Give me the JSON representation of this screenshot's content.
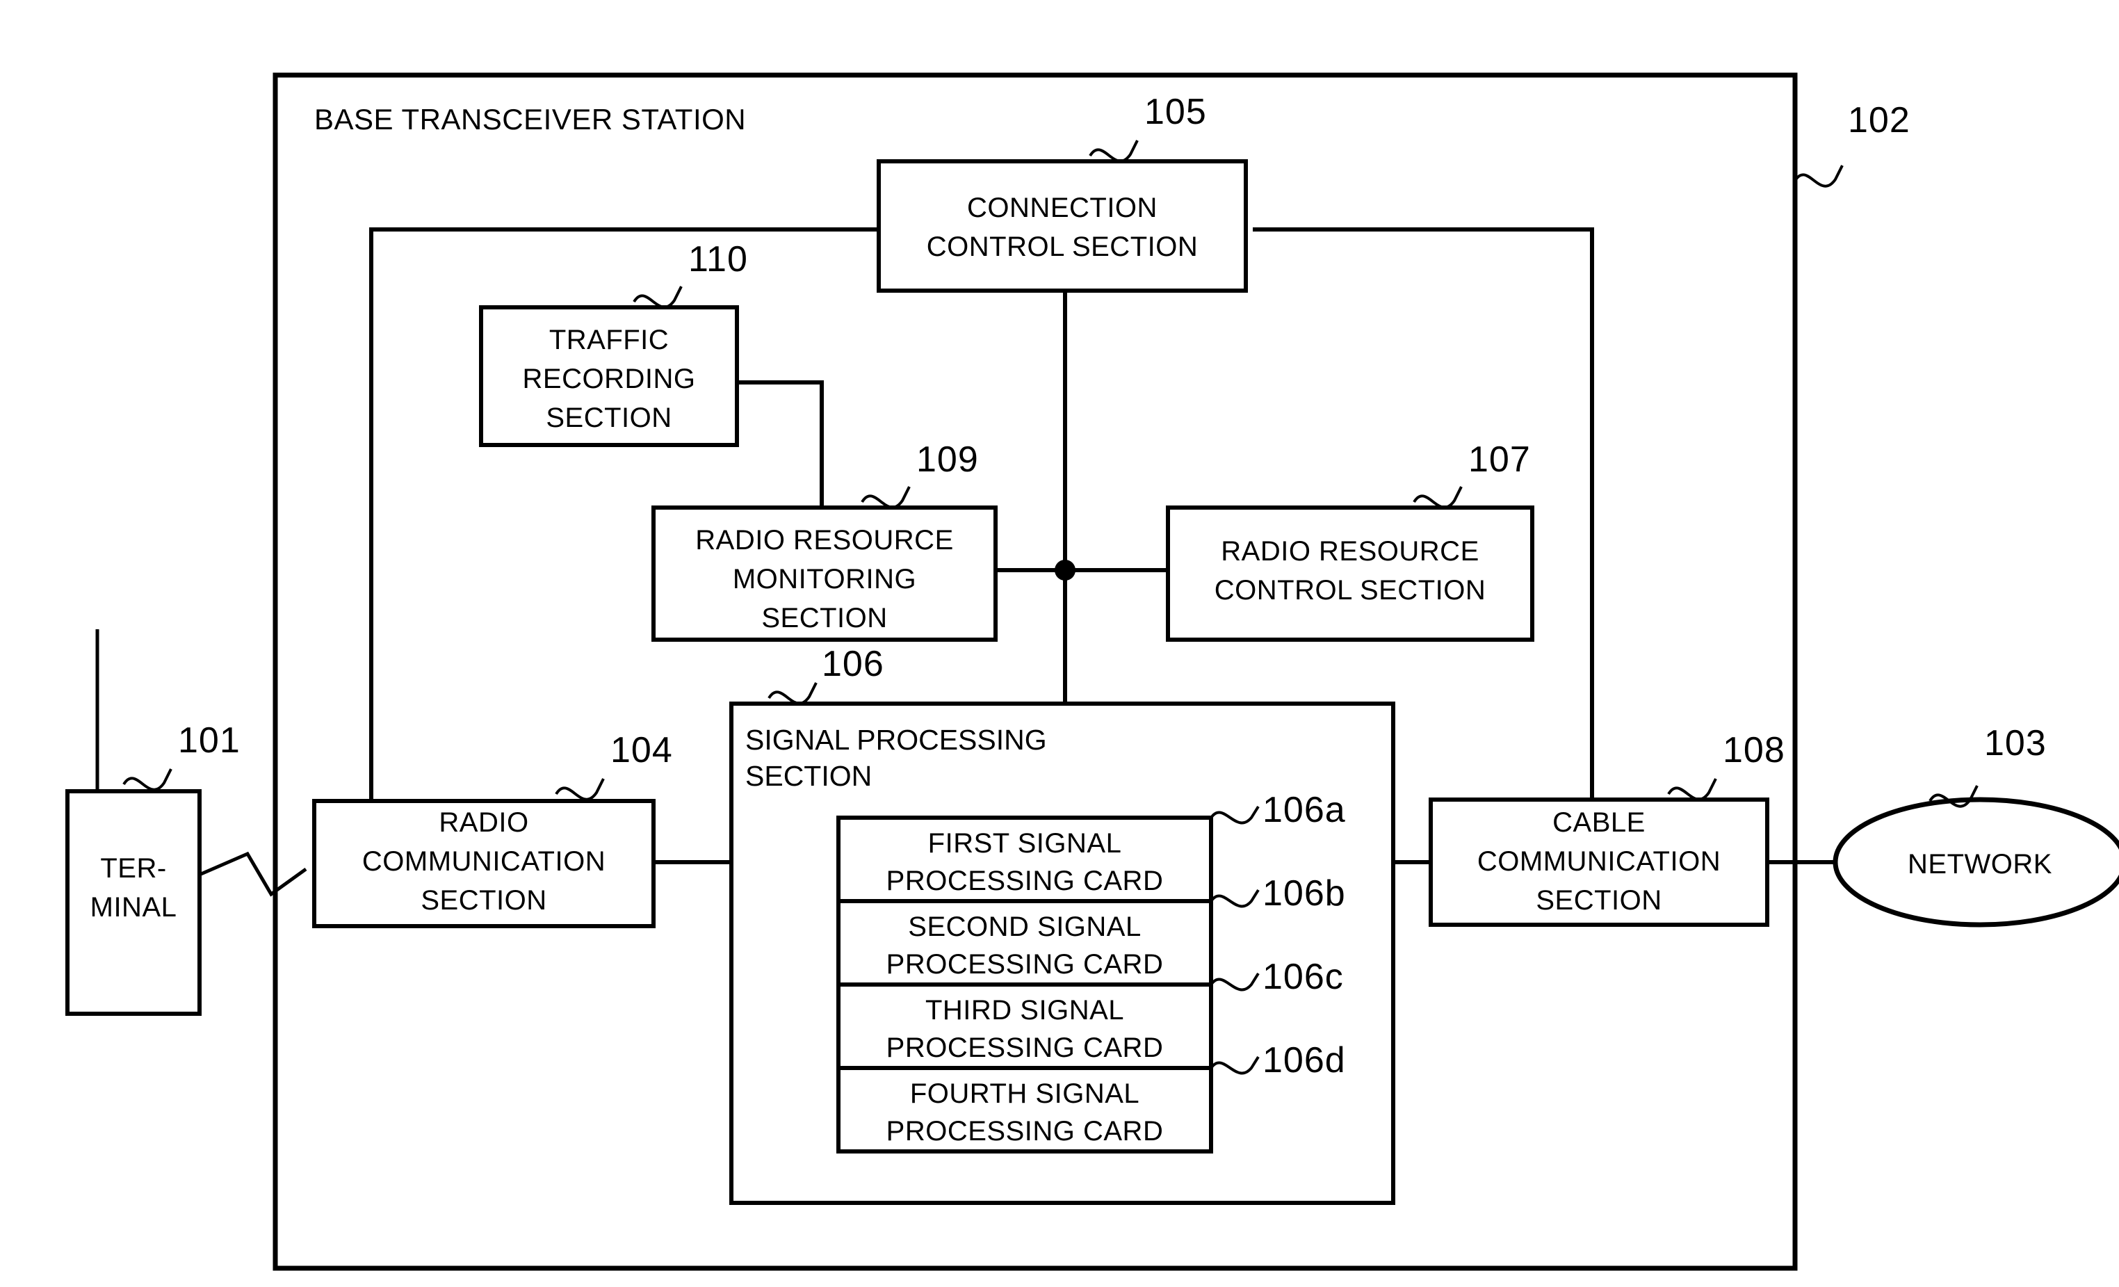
{
  "figure": {
    "title": "BASE TRANSCEIVER STATION",
    "outer_ref": "102"
  },
  "nodes": {
    "terminal": {
      "label_line1": "TER-",
      "label_line2": "MINAL",
      "ref": "101"
    },
    "network": {
      "label": "NETWORK",
      "ref": "103"
    },
    "radio_communication": {
      "line1": "RADIO",
      "line2": "COMMUNICATION",
      "line3": "SECTION",
      "ref": "104"
    },
    "connection_control": {
      "line1": "CONNECTION",
      "line2": "CONTROL SECTION",
      "ref": "105"
    },
    "signal_processing": {
      "line1": "SIGNAL PROCESSING",
      "line2": "SECTION",
      "ref": "106"
    },
    "radio_resource_control": {
      "line1": "RADIO RESOURCE",
      "line2": "CONTROL SECTION",
      "ref": "107"
    },
    "cable_communication": {
      "line1": "CABLE",
      "line2": "COMMUNICATION",
      "line3": "SECTION",
      "ref": "108"
    },
    "radio_resource_monitoring": {
      "line1": "RADIO RESOURCE",
      "line2": "MONITORING",
      "line3": "SECTION",
      "ref": "109"
    },
    "traffic_recording": {
      "line1": "TRAFFIC",
      "line2": "RECORDING",
      "line3": "SECTION",
      "ref": "110"
    }
  },
  "cards": [
    {
      "line1": "FIRST SIGNAL",
      "line2": "PROCESSING CARD",
      "ref": "106a"
    },
    {
      "line1": "SECOND SIGNAL",
      "line2": "PROCESSING CARD",
      "ref": "106b"
    },
    {
      "line1": "THIRD SIGNAL",
      "line2": "PROCESSING CARD",
      "ref": "106c"
    },
    {
      "line1": "FOURTH SIGNAL",
      "line2": "PROCESSING CARD",
      "ref": "106d"
    }
  ],
  "colors": {
    "ink": "#000000",
    "paper": "#ffffff"
  }
}
